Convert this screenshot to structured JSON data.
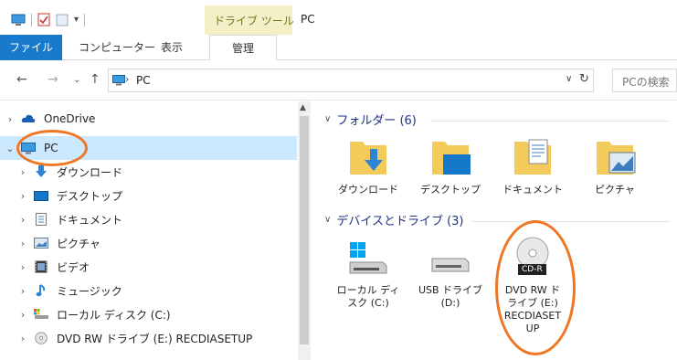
{
  "title_bar": {
    "context_group": "ドライブ ツール",
    "window_title": "PC"
  },
  "ribbon": {
    "tabs": [
      "ファイル",
      "コンピューター",
      "表示",
      "管理"
    ]
  },
  "address_bar": {
    "location": "PC",
    "search_placeholder": "PCの検索"
  },
  "nav_pane": {
    "items": [
      {
        "label": "OneDrive",
        "icon": "cloud-icon"
      },
      {
        "label": "PC",
        "icon": "computer-icon"
      },
      {
        "label": "ダウンロード",
        "icon": "download-icon"
      },
      {
        "label": "デスクトップ",
        "icon": "desktop-icon"
      },
      {
        "label": "ドキュメント",
        "icon": "document-icon"
      },
      {
        "label": "ピクチャ",
        "icon": "pictures-icon"
      },
      {
        "label": "ビデオ",
        "icon": "video-icon"
      },
      {
        "label": "ミュージック",
        "icon": "music-icon"
      },
      {
        "label": "ローカル ディスク (C:)",
        "icon": "local-disk-icon"
      },
      {
        "label": "DVD RW ドライブ (E:) RECDIASETUP",
        "icon": "dvd-drive-icon"
      }
    ]
  },
  "main": {
    "folders_header": "フォルダー (6)",
    "folders": [
      {
        "label": "ダウンロード"
      },
      {
        "label": "デスクトップ"
      },
      {
        "label": "ドキュメント"
      },
      {
        "label": "ピクチャ"
      }
    ],
    "devices_header": "デバイスとドライブ (3)",
    "devices": [
      {
        "line1": "ローカル ディ",
        "line2": "スク (C:)"
      },
      {
        "line1": "USB ドライブ",
        "line2": "(D:)"
      },
      {
        "line1": "DVD RW ド",
        "line2": "ライブ (E:)",
        "line3": "RECDIASET",
        "line4": "UP",
        "badge": "CD-R"
      }
    ]
  },
  "colors": {
    "accent": "#1979ca",
    "selection": "#cce8ff",
    "highlight": "#ef7622",
    "group_header": "#1e3287",
    "folder": "#f3cb5a"
  }
}
